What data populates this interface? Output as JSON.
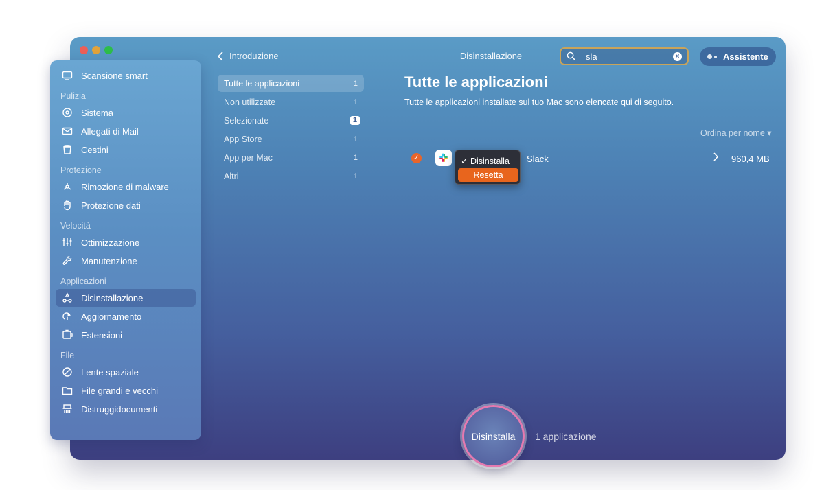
{
  "header": {
    "back_label": "Introduzione",
    "title": "Disinstallazione",
    "search_value": "sla",
    "assistant_label": "Assistente"
  },
  "sidebar": {
    "top_item": "Scansione smart",
    "sections": [
      {
        "title": "Pulizia",
        "items": [
          "Sistema",
          "Allegati di Mail",
          "Cestini"
        ]
      },
      {
        "title": "Protezione",
        "items": [
          "Rimozione di malware",
          "Protezione dati"
        ]
      },
      {
        "title": "Velocità",
        "items": [
          "Ottimizzazione",
          "Manutenzione"
        ]
      },
      {
        "title": "Applicazioni",
        "items": [
          "Disinstallazione",
          "Aggiornamento",
          "Estensioni"
        ]
      },
      {
        "title": "File",
        "items": [
          "Lente spaziale",
          "File grandi e vecchi",
          "Distruggidocumenti"
        ]
      }
    ]
  },
  "categories": [
    {
      "label": "Tutte le applicazioni",
      "count": "1"
    },
    {
      "label": "Non utilizzate",
      "count": "1"
    },
    {
      "label": "Selezionate",
      "count": "1"
    },
    {
      "label": "App Store",
      "count": "1"
    },
    {
      "label": "App per Mac",
      "count": "1"
    },
    {
      "label": "Altri",
      "count": "1"
    }
  ],
  "main": {
    "title": "Tutte le applicazioni",
    "subtitle": "Tutte le applicazioni installate sul tuo Mac sono elencate qui di seguito.",
    "sort_label": "Ordina per nome ▾"
  },
  "app_row": {
    "name": "Slack",
    "size": "960,4 MB",
    "checked": true
  },
  "dropdown": {
    "option_selected": "✓ Disinstalla",
    "option_highlight": "Resetta"
  },
  "bottom": {
    "button_label": "Disinstalla",
    "count_label": "1 applicazione"
  },
  "colors": {
    "accent": "#e8651d",
    "search_border": "#c9a45a",
    "button_ring": "#e47ab0"
  }
}
